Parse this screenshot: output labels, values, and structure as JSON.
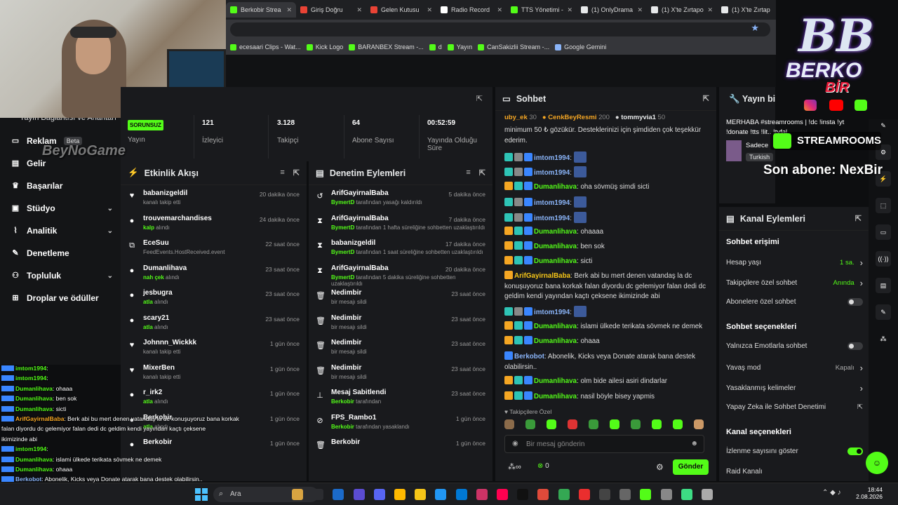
{
  "browser": {
    "tabs": [
      {
        "label": "Berkobir Strea",
        "color": "#53fc18",
        "active": true
      },
      {
        "label": "Giriş Doğru",
        "color": "#ea4335"
      },
      {
        "label": "Gelen Kutusu",
        "color": "#ea4335"
      },
      {
        "label": "Radio Record",
        "color": "#ffffff"
      },
      {
        "label": "TTS Yönetimi -",
        "color": "#53fc18"
      },
      {
        "label": "(1) OnlyDrama",
        "color": "#e7e9ea"
      },
      {
        "label": "(1) X'te Zırtapo",
        "color": "#e7e9ea"
      },
      {
        "label": "(1) X'te Zırtap",
        "color": "#e7e9ea"
      }
    ],
    "bookmarks": [
      {
        "label": "ecesaari Clips - Wat...",
        "color": "#53fc18"
      },
      {
        "label": "Kick Logo",
        "color": "#53fc18"
      },
      {
        "label": "BARANBEX Stream -...",
        "color": "#53fc18"
      },
      {
        "label": "d",
        "color": "#53fc18"
      },
      {
        "label": "Yayın",
        "color": "#53fc18"
      },
      {
        "label": "CanSakizlii Stream -...",
        "color": "#53fc18"
      },
      {
        "label": "Google Gemini",
        "color": "#8ab4f8"
      }
    ]
  },
  "sidebar": {
    "partial_title": "Yayın Bağlantısı ve Anahtarı",
    "items": [
      {
        "label": "Reklam",
        "icon": "monitor-icon",
        "badge": "Beta"
      },
      {
        "label": "Gelir",
        "icon": "wallet-icon"
      },
      {
        "label": "Başarılar",
        "icon": "trophy-icon"
      },
      {
        "label": "Stüdyo",
        "icon": "studio-icon",
        "chevron": "⌄"
      },
      {
        "label": "Analitik",
        "icon": "analytics-icon",
        "chevron": "⌄"
      },
      {
        "label": "Denetleme",
        "icon": "wrench-icon"
      },
      {
        "label": "Topluluk",
        "icon": "community-icon",
        "chevron": "⌄"
      },
      {
        "label": "Droplar ve ödüller",
        "icon": "drops-icon"
      }
    ]
  },
  "stats": {
    "status_badge": "SORUNSUZ",
    "items": [
      {
        "value": "",
        "label": "Yayın"
      },
      {
        "value": "121",
        "label": "İzleyici"
      },
      {
        "value": "3.128",
        "label": "Takipçi"
      },
      {
        "value": "64",
        "label": "Abone Sayısı"
      },
      {
        "value": "00:52:59",
        "label": "Yayında Olduğu Süre"
      }
    ]
  },
  "activity": {
    "title": "Etkinlik Akışı",
    "items": [
      {
        "name": "babanizgeldil",
        "sub": "kanalı takip etti",
        "time": "20 dakika önce",
        "icon": "♥"
      },
      {
        "name": "trouvemarchandises",
        "sub_hl": "kalp",
        "sub": " alındı",
        "time": "24 dakika önce",
        "icon": "●"
      },
      {
        "name": "EceSuu",
        "sub": "FeedEvents.HostReceived.event",
        "time": "22 saat önce",
        "icon": "⧉"
      },
      {
        "name": "Dumanlihava",
        "sub_hl": "nah çek",
        "sub": " alındı",
        "time": "23 saat önce",
        "icon": "●"
      },
      {
        "name": "jesbugra",
        "sub_hl": "atla",
        "sub": " alındı",
        "time": "23 saat önce",
        "icon": "●"
      },
      {
        "name": "scary21",
        "sub_hl": "atla",
        "sub": " alındı",
        "time": "23 saat önce",
        "icon": "●"
      },
      {
        "name": "Johnnn_Wickkk",
        "sub": "kanalı takip etti",
        "time": "1 gün önce",
        "icon": "♥"
      },
      {
        "name": "MixerBen",
        "sub": "kanalı takip etti",
        "time": "1 gün önce",
        "icon": "♥"
      },
      {
        "name": "r_irk2",
        "sub_hl": "atla",
        "sub": " alındı",
        "time": "1 gün önce",
        "icon": "●"
      },
      {
        "name": "Berkobir",
        "sub_hl": "atla",
        "sub": " alındı",
        "time": "1 gün önce",
        "icon": "●"
      },
      {
        "name": "Berkobir",
        "sub": "",
        "time": "1 gün önce",
        "icon": "●"
      }
    ]
  },
  "moderation": {
    "title": "Denetim Eylemleri",
    "items": [
      {
        "name": "ArifGayirnalBaba",
        "sub_hl": "BymertD",
        "sub": " tarafından yasağı kaldırıldı",
        "time": "5 dakika önce",
        "icon": "↺"
      },
      {
        "name": "ArifGayirnalBaba",
        "sub_hl": "BymertD",
        "sub": " tarafından 1 hafta süreliğine sohbetten uzaklaştırıldı",
        "time": "7 dakika önce",
        "icon": "⧗"
      },
      {
        "name": "babanizgeldil",
        "sub_hl": "BymertD",
        "sub": " tarafından 1 saat süreliğine sohbetten uzaklaştırıldı",
        "time": "17 dakika önce",
        "icon": "⧗"
      },
      {
        "name": "ArifGayirnalBaba",
        "sub_hl": "BymertD",
        "sub": " tarafından 5 dakika süreliğine sohbetten uzaklaştırıldı",
        "time": "20 dakika önce",
        "icon": "⧗"
      },
      {
        "name": "Nedimbir",
        "sub": "bir mesajı sildi",
        "time": "23 saat önce",
        "icon": "🗑"
      },
      {
        "name": "Nedimbir",
        "sub": "bir mesajı sildi",
        "time": "23 saat önce",
        "icon": "🗑"
      },
      {
        "name": "Nedimbir",
        "sub": "bir mesajı sildi",
        "time": "23 saat önce",
        "icon": "🗑"
      },
      {
        "name": "Nedimbir",
        "sub": "bir mesajı sildi",
        "time": "23 saat önce",
        "icon": "🗑"
      },
      {
        "name": "Mesaj Sabitlendi",
        "sub_hl": "Berkobir",
        "sub": " tarafından",
        "time": "23 saat önce",
        "icon": "⊥"
      },
      {
        "name": "FPS_Rambo1",
        "sub_hl": "Berkobir",
        "sub": " tarafından yasaklandı",
        "time": "1 gün önce",
        "icon": "⊘"
      },
      {
        "name": "Berkobir",
        "sub": "",
        "time": "1 gün önce",
        "icon": "🗑"
      }
    ]
  },
  "chat": {
    "title": "Sohbet",
    "top_users": [
      {
        "name": "uby_ek",
        "count": "30"
      },
      {
        "name": "CenkBeyResmi",
        "count": "200"
      },
      {
        "name": "tommyvia1",
        "count": "50"
      }
    ],
    "messages": [
      {
        "user": "",
        "text": "minimum 50 ₺ gözükür. Desteklerinizi için şimdiden çok teşekkür ederim.",
        "color": "#ddd"
      },
      {
        "user": "imtom1994",
        "text": "",
        "color": "#8ab4f8",
        "emote": true
      },
      {
        "user": "imtom1994",
        "text": "",
        "color": "#8ab4f8",
        "emote": true
      },
      {
        "user": "Dumanlihava",
        "text": "oha sövmüş simdi sicti",
        "color": "#53fc18"
      },
      {
        "user": "imtom1994",
        "text": "",
        "color": "#8ab4f8",
        "emote": true
      },
      {
        "user": "imtom1994",
        "text": "",
        "color": "#8ab4f8",
        "emote": true
      },
      {
        "user": "Dumanlihava",
        "text": "ohaaaa",
        "color": "#53fc18"
      },
      {
        "user": "Dumanlihava",
        "text": "ben sok",
        "color": "#53fc18"
      },
      {
        "user": "Dumanlihava",
        "text": "sicti",
        "color": "#53fc18"
      },
      {
        "user": "ArifGayirnalBaba",
        "text": "Berk abi bu mert denen vatandaş la dc konuşuyoruz bana korkak falan diyordu dc gelemiyor falan dedi dc geldim kendi yayından kaçtı çeksene ikimizinde abi",
        "color": "#f5c518"
      },
      {
        "user": "imtom1994",
        "text": "",
        "color": "#8ab4f8",
        "emote": true
      },
      {
        "user": "Dumanlihava",
        "text": "islami ülkede terikata sövmek ne demek",
        "color": "#53fc18"
      },
      {
        "user": "Dumanlihava",
        "text": "ohaaa",
        "color": "#53fc18"
      },
      {
        "user": "Berkobot",
        "text": "Abonelik, Kicks veya Donate atarak bana destek olabilirsin..",
        "color": "#8ab4f8"
      },
      {
        "user": "Dumanlihava",
        "text": "olm bide ailesi asiri dindarlar",
        "color": "#53fc18"
      },
      {
        "user": "Dumanlihava",
        "text": "nasil böyle bisey yapmis",
        "color": "#53fc18"
      }
    ],
    "followers_only": "Takipçilere Özel",
    "input_placeholder": "Bir mesaj gönderin",
    "kicks_count": "0",
    "send_label": "Gönder"
  },
  "stream_info": {
    "title": "Yayın bi",
    "text": "MERHABA #streamrooms | !dc !insta !yt !donate !tts !lit.. !tyfal",
    "user_partial": "Sadece",
    "tag": "Turkish"
  },
  "channel_actions": {
    "title": "Kanal Eylemleri",
    "section1": "Sohbet erişimi",
    "rows1": [
      {
        "label": "Hesap yaşı",
        "value": "1 sa.",
        "green": true,
        "type": "chevron"
      },
      {
        "label": "Takipçilere özel sohbet",
        "value": "Anında",
        "green": true,
        "type": "chevron"
      },
      {
        "label": "Abonelere özel sohbet",
        "value": "",
        "type": "toggle",
        "on": false
      }
    ],
    "section2": "Sohbet seçenekleri",
    "rows2": [
      {
        "label": "Yalnızca Emotlarla sohbet",
        "value": "",
        "type": "toggle",
        "on": false
      },
      {
        "label": "Yavaş mod",
        "value": "Kapalı",
        "type": "chevron"
      },
      {
        "label": "Yasaklanmış kelimeler",
        "value": "",
        "type": "chevron"
      },
      {
        "label": "Yapay Zeka ile Sohbet Denetimi",
        "value": "",
        "type": "ext"
      }
    ],
    "section3": "Kanal seçenekleri",
    "rows3": [
      {
        "label": "İzlenme sayısını göster",
        "value": "",
        "type": "toggle",
        "on": true
      },
      {
        "label": "Raid Kanalı",
        "value": "",
        "type": "none"
      }
    ]
  },
  "overlay": {
    "logo_line1": "BB",
    "logo_line2": "BERKO",
    "logo_line3": "BİR",
    "streamrooms": "STREAMROOMS",
    "last_sub": "Son abone: NexBir",
    "game_text": "BeyNoGame",
    "chat_lines": [
      {
        "u": "imtom1994",
        "t": ":"
      },
      {
        "u": "imtom1994",
        "t": ":"
      },
      {
        "u": "Dumanlihava",
        "t": ": ohaaa"
      },
      {
        "u": "Dumanlihava",
        "t": ": ben sok"
      },
      {
        "u": "Dumanlihava",
        "t": ": sicti"
      },
      {
        "u": "ArifGayirnalBaba",
        "t": ": Berk abi bu mert denen vatandaş la dc konuşuyoruz bana korkak"
      },
      {
        "u": "",
        "t": "falan diyordu dc gelemiyor falan dedi dc geldim kendi yayından kaçtı çeksene"
      },
      {
        "u": "",
        "t": "ikimizinde abi"
      },
      {
        "u": "imtom1994",
        "t": ":"
      },
      {
        "u": "Dumanlihava",
        "t": ": islami ülkede terikata sövmek ne demek"
      },
      {
        "u": "Dumanlihava",
        "t": ": ohaaa"
      },
      {
        "u": "Berkobot",
        "t": ": Abonelik, Kicks veya Donate atarak bana destek olabilirsin.."
      },
      {
        "u": "Dumanlihava",
        "t": ": olm bide ailesi asiri dindarlar"
      },
      {
        "u": "Dumanlihava",
        "t": ": nasil böyle bisey yapmis"
      }
    ]
  },
  "taskbar": {
    "search": "Ara",
    "time": "18:44",
    "date": "2.08.2026"
  },
  "colors": {
    "kick_green": "#53fc18",
    "panel": "#191a1d",
    "bg": "#0d0e10"
  }
}
